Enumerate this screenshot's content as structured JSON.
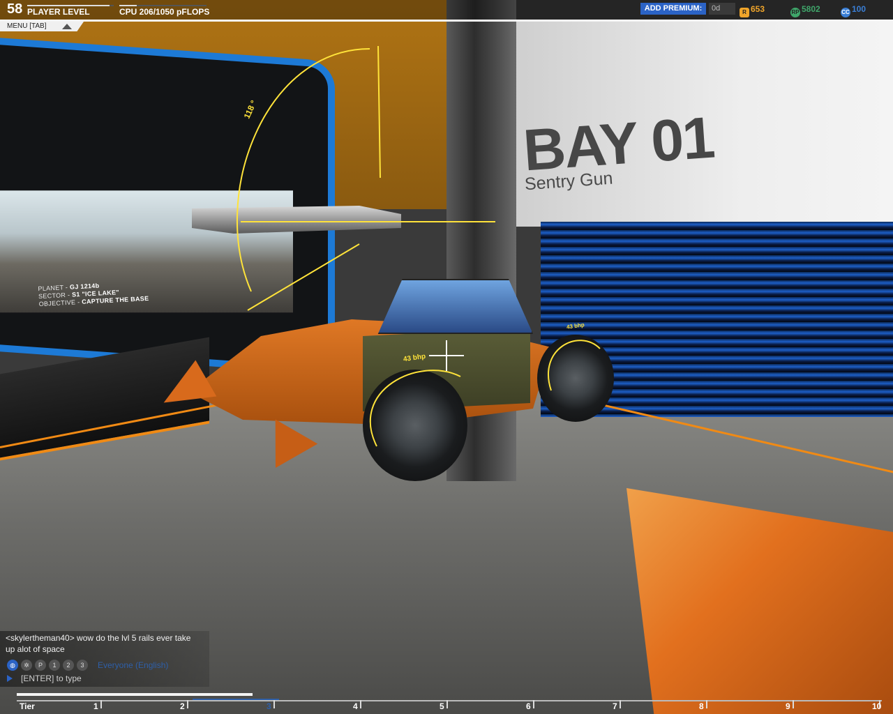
{
  "hud": {
    "player_level": "58",
    "player_level_label": "PLAYER LEVEL",
    "level_progress": 0.95,
    "cpu_label": "CPU 206/1050 pFLOPS",
    "cpu_fraction": 0.196,
    "menu_label": "MENU [TAB]",
    "premium_label": "ADD PREMIUM:",
    "premium_days": "0d",
    "robits": "653",
    "rp": "5802",
    "cosmetic_credits": "100",
    "robits_icon": "robits-icon",
    "rp_icon": "rp-icon",
    "cc_icon": "cc-icon",
    "colors": {
      "premium": "#2b63c6",
      "robits": "#f0a52a",
      "rp": "#3fa66a",
      "cc": "#3a7fd6"
    }
  },
  "scene": {
    "bay_title": "BAY 01",
    "bay_subtitle": "Sentry Gun",
    "mission_planet_key": "PLANET - ",
    "mission_planet": "GJ 1214b",
    "mission_sector_key": "SECTOR - ",
    "mission_sector": "S1 \"ICE LAKE\"",
    "mission_objective_key": "OBJECTIVE - ",
    "mission_objective": "CAPTURE THE BASE",
    "angle_label": "118 °",
    "bhp_front": "43 bhp",
    "bhp_rear": "43 bhp"
  },
  "chat": {
    "message": "<skylertheman40> wow do the lvl 5 rails ever take up alot of space",
    "channel": "Everyone (English)",
    "input_placeholder": "[ENTER] to type",
    "icons": [
      {
        "name": "globe-icon",
        "glyph": "◍",
        "active": true
      },
      {
        "name": "clan-icon",
        "glyph": "✲",
        "active": false
      },
      {
        "name": "party-icon",
        "glyph": "P",
        "active": false
      },
      {
        "name": "whisper-1-icon",
        "glyph": "1",
        "active": false
      },
      {
        "name": "whisper-2-icon",
        "glyph": "2",
        "active": false
      },
      {
        "name": "whisper-3-icon",
        "glyph": "3",
        "active": false
      }
    ]
  },
  "tier_bar": {
    "label": "Tier",
    "current": 3,
    "ticks": [
      "1",
      "2",
      "3",
      "4",
      "5",
      "6",
      "7",
      "8",
      "9",
      "10"
    ]
  }
}
